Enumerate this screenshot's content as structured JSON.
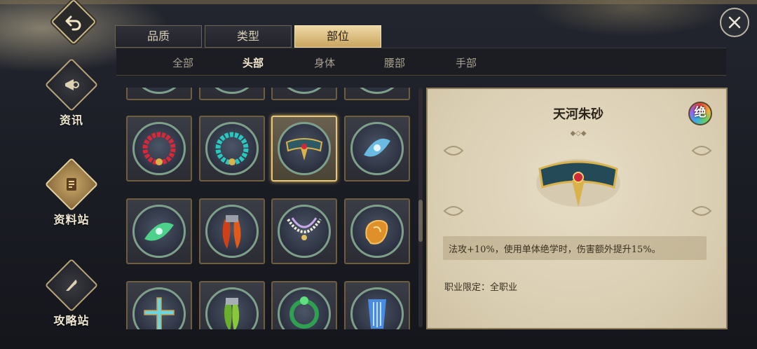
{
  "nav": {
    "items": [
      {
        "label": "资讯",
        "icon": "horn-icon",
        "active": false
      },
      {
        "label": "资料站",
        "icon": "scroll-icon",
        "active": true
      },
      {
        "label": "攻略站",
        "icon": "quill-icon",
        "active": false
      }
    ]
  },
  "filters": {
    "tabs": [
      {
        "label": "品质",
        "active": false
      },
      {
        "label": "类型",
        "active": false
      },
      {
        "label": "部位",
        "active": true
      }
    ],
    "subtabs": [
      {
        "label": "全部",
        "active": false
      },
      {
        "label": "头部",
        "active": true
      },
      {
        "label": "身体",
        "active": false
      },
      {
        "label": "腰部",
        "active": false
      },
      {
        "label": "手部",
        "active": false
      }
    ]
  },
  "grid": {
    "items": [
      {
        "name": "red-bead-bracelet-item",
        "icon": "bead-bracelet-red",
        "selected": false
      },
      {
        "name": "teal-bead-bracelet-item",
        "icon": "bead-bracelet-teal",
        "selected": false
      },
      {
        "name": "gold-headband-item",
        "icon": "headband-gold",
        "selected": true
      },
      {
        "name": "blue-jade-ornament-item",
        "icon": "jade-ornament-blue",
        "selected": false
      },
      {
        "name": "green-jade-ornament-item",
        "icon": "jade-ornament-green",
        "selected": false
      },
      {
        "name": "red-fang-pendant-item",
        "icon": "fang-pendant",
        "selected": false
      },
      {
        "name": "pearl-necklace-item",
        "icon": "pearl-necklace",
        "selected": false
      },
      {
        "name": "gold-pendant-item",
        "icon": "gold-pendant",
        "selected": false
      },
      {
        "name": "cross-pendant-item",
        "icon": "cross-pendant",
        "selected": false
      },
      {
        "name": "green-fang-item",
        "icon": "green-fang",
        "selected": false
      },
      {
        "name": "green-ring-item",
        "icon": "green-ring",
        "selected": false
      },
      {
        "name": "blue-tassel-item",
        "icon": "blue-tassel",
        "selected": false
      }
    ]
  },
  "detail": {
    "title": "天河朱砂",
    "rarity": "绝",
    "description": "法攻+10%，使用单体绝学时，伤害额外提升15%。",
    "job_restriction": "职业限定：全职业"
  },
  "colors": {
    "accent_gold": "#e8c777",
    "panel_bg": "#1c1d23",
    "card_bg": "#e2d8c0"
  }
}
